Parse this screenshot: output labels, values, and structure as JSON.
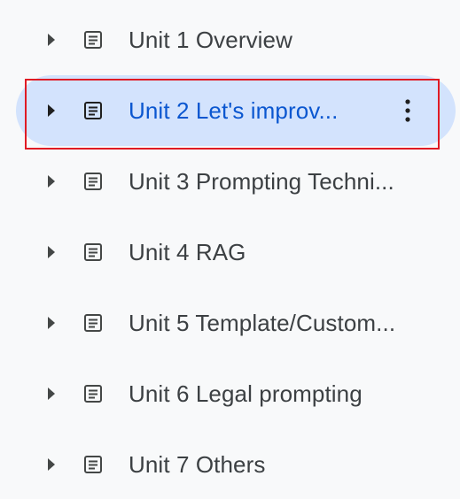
{
  "outline": {
    "items": [
      {
        "label": "Unit 1 Overview",
        "selected": false
      },
      {
        "label": "Unit 2 Let's improv...",
        "selected": true
      },
      {
        "label": "Unit 3 Prompting Techni...",
        "selected": false
      },
      {
        "label": "Unit 4 RAG",
        "selected": false
      },
      {
        "label": "Unit 5 Template/Custom...",
        "selected": false
      },
      {
        "label": "Unit 6 Legal prompting",
        "selected": false
      },
      {
        "label": "Unit 7 Others",
        "selected": false
      }
    ],
    "icons": {
      "expand": "caret-right-icon",
      "document": "document-icon",
      "more": "more-vertical-icon"
    },
    "colors": {
      "selected_background": "#d3e3fd",
      "selected_text": "#0b57d0",
      "text": "#3c4043",
      "icon": "#444746",
      "annotation_border": "#e01b24"
    }
  }
}
